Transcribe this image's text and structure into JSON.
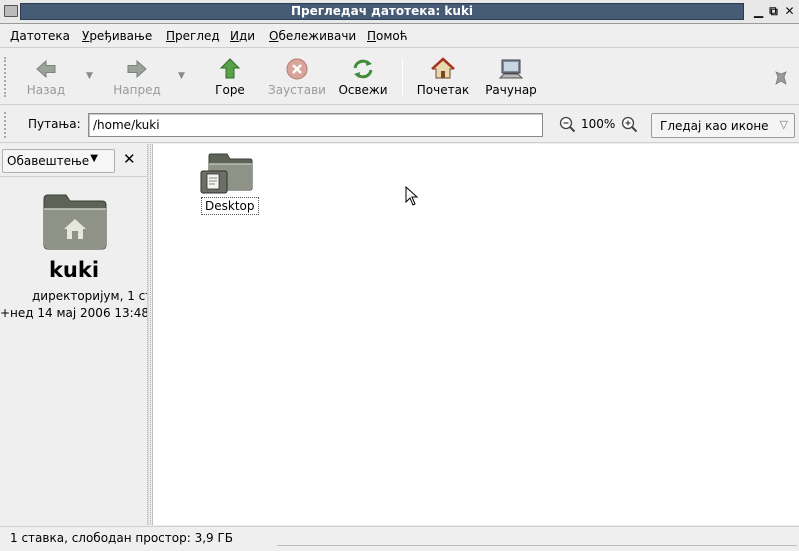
{
  "window": {
    "title": "Прегледач датотека: kuki"
  },
  "menu": {
    "items": [
      {
        "first": "Д",
        "rest": "атотека"
      },
      {
        "first": "У",
        "rest": "ређивање"
      },
      {
        "first": "П",
        "rest": "реглед"
      },
      {
        "first": "И",
        "rest": "ди"
      },
      {
        "first": "О",
        "rest": "бележивачи"
      },
      {
        "first": "П",
        "rest": "омоћ"
      }
    ]
  },
  "toolbar": {
    "back": "Назад",
    "forward": "Напред",
    "up": "Горе",
    "stop": "Заустави",
    "reload": "Освежи",
    "home": "Почетак",
    "computer": "Рачунар"
  },
  "location": {
    "label": "Путања:",
    "value": "/home/kuki",
    "zoom": "100%",
    "view_mode": "Гледај као иконе"
  },
  "sidepane": {
    "selector": "Обавештење",
    "name": "kuki",
    "type": "директоријум, 1 ст",
    "date": "+нед 14 мај 2006 13:48"
  },
  "files": [
    {
      "name": "Desktop",
      "icon": "folder-desktop-icon"
    }
  ],
  "status": {
    "text": "1 ставка, слободан простор: 3,9 ГБ"
  }
}
